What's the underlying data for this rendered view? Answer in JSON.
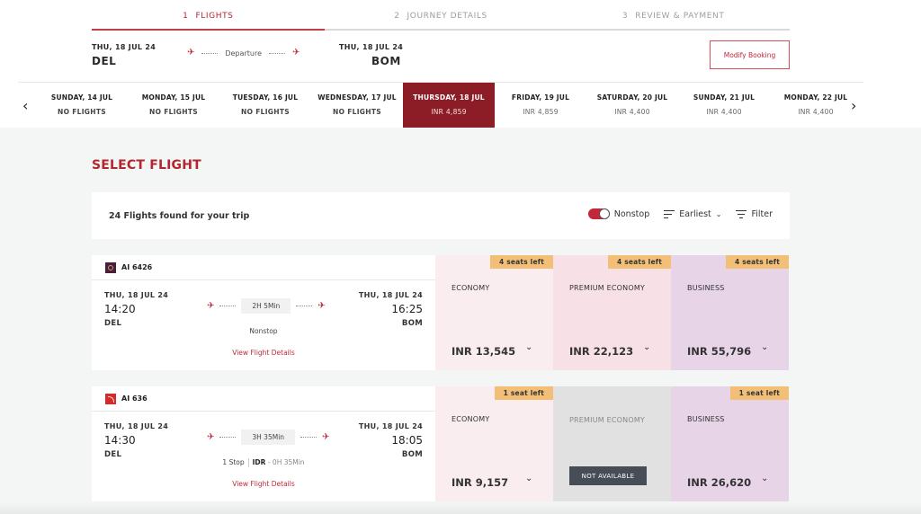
{
  "steps": [
    {
      "num": "1",
      "label": "FLIGHTS",
      "active": true
    },
    {
      "num": "2",
      "label": "JOURNEY DETAILS",
      "active": false
    },
    {
      "num": "3",
      "label": "REVIEW & PAYMENT",
      "active": false
    }
  ],
  "route": {
    "departure_date": "THU, 18 JUL 24",
    "departure_code": "DEL",
    "arrival_date": "THU, 18 JUL 24",
    "arrival_code": "BOM",
    "mid_label": "Departure"
  },
  "modify_booking_label": "Modify Booking",
  "date_bar": {
    "dates": [
      {
        "day": "SUNDAY, 14 JUL",
        "price": "NO FLIGHTS",
        "no_flights": true
      },
      {
        "day": "MONDAY, 15 JUL",
        "price": "NO FLIGHTS",
        "no_flights": true
      },
      {
        "day": "TUESDAY, 16 JUL",
        "price": "NO FLIGHTS",
        "no_flights": true
      },
      {
        "day": "WEDNESDAY, 17 JUL",
        "price": "NO FLIGHTS",
        "no_flights": true
      },
      {
        "day": "THURSDAY, 18 JUL",
        "price": "INR 4,859",
        "selected": true
      },
      {
        "day": "FRIDAY, 19 JUL",
        "price": "INR 4,859"
      },
      {
        "day": "SATURDAY, 20 JUL",
        "price": "INR 4,400"
      },
      {
        "day": "SUNDAY, 21 JUL",
        "price": "INR 4,400"
      },
      {
        "day": "MONDAY, 22 JUL",
        "price": "INR 4,400"
      }
    ],
    "prev_icon": "‹",
    "next_icon": "›"
  },
  "page_title": "SELECT FLIGHT",
  "results": {
    "count_text": "24 Flights found for your trip",
    "nonstop_label": "Nonstop",
    "nonstop_on": true,
    "sort_label": "Earliest",
    "filter_label": "Filter"
  },
  "flights": [
    {
      "flight_no": "AI 6426",
      "dep_date": "THU, 18 JUL 24",
      "dep_time": "14:20",
      "dep_code": "DEL",
      "arr_date": "THU, 18 JUL 24",
      "arr_time": "16:25",
      "arr_code": "BOM",
      "duration": "2H 5Min",
      "stops": "Nonstop",
      "view_details": "View Flight Details",
      "fares": {
        "economy": {
          "cabin": "ECONOMY",
          "seats": "4 seats left",
          "price": "INR 13,545"
        },
        "premium": {
          "cabin": "PREMIUM ECONOMY",
          "seats": "4 seats left",
          "price": "INR 22,123"
        },
        "business": {
          "cabin": "BUSINESS",
          "seats": "4 seats left",
          "price": "INR 55,796"
        }
      }
    },
    {
      "flight_no": "AI 636",
      "dep_date": "THU, 18 JUL 24",
      "dep_time": "14:30",
      "dep_code": "DEL",
      "arr_date": "THU, 18 JUL 24",
      "arr_time": "18:05",
      "arr_code": "BOM",
      "duration": "3H 35Min",
      "stops": "1 Stop",
      "stop_airport": "IDR",
      "layover": "- 0H 35Min",
      "view_details": "View Flight Details",
      "fares": {
        "economy": {
          "cabin": "ECONOMY",
          "seats": "1 seat left",
          "price": "INR 9,157"
        },
        "premium": {
          "cabin": "PREMIUM ECONOMY",
          "status": "NOT AVAILABLE"
        },
        "business": {
          "cabin": "BUSINESS",
          "seats": "1 seat left",
          "price": "INR 26,620"
        }
      }
    }
  ],
  "icons": {
    "takeoff": "✈",
    "chevron_down": "⌄"
  }
}
